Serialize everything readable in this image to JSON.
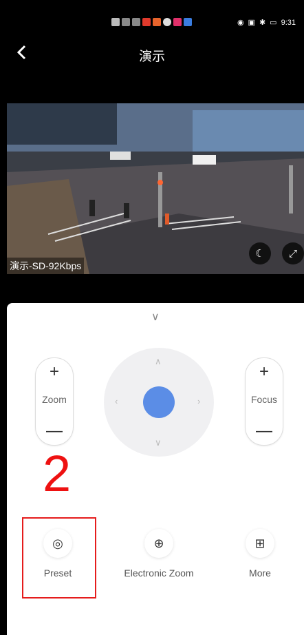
{
  "status_bar": {
    "time": "9:31"
  },
  "header": {
    "back_icon": "chevron-left-icon",
    "title": "演示"
  },
  "video": {
    "stream_label": "演示-SD-92Kbps"
  },
  "controls": {
    "zoom": {
      "plus": "+",
      "label": "Zoom",
      "minus": "—"
    },
    "focus": {
      "plus": "+",
      "label": "Focus",
      "minus": "—"
    }
  },
  "annotation": {
    "number": "2"
  },
  "tools": {
    "preset": {
      "label": "Preset"
    },
    "electronic_zoom": {
      "label": "Electronic Zoom"
    },
    "more": {
      "label": "More"
    }
  },
  "colors": {
    "accent": "#5b8de6",
    "highlight": "#e51c1c"
  }
}
